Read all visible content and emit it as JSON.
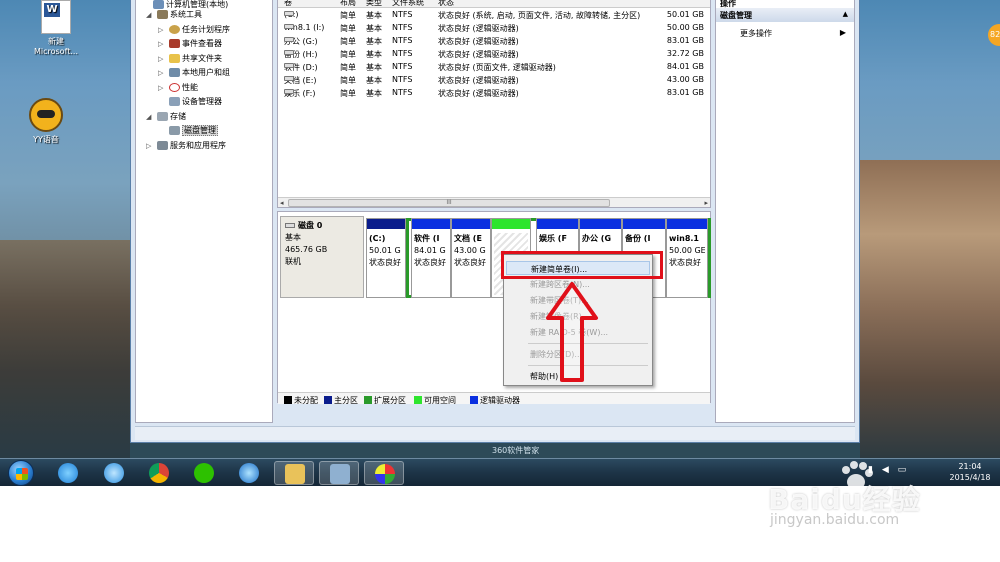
{
  "desktop": {
    "icons": [
      {
        "label": "新建\nMicrosoft..."
      },
      {
        "label": "YY语音"
      }
    ],
    "overlay_text": "360软件管家"
  },
  "nav_tree": {
    "items": [
      {
        "label": "计算机管理(本地)",
        "glyph": "",
        "level": 0
      },
      {
        "label": "系统工具",
        "glyph": "◢",
        "level": 1
      },
      {
        "label": "任务计划程序",
        "glyph": "▷",
        "level": 2
      },
      {
        "label": "事件查看器",
        "glyph": "▷",
        "level": 2
      },
      {
        "label": "共享文件夹",
        "glyph": "▷",
        "level": 2
      },
      {
        "label": "本地用户和组",
        "glyph": "▷",
        "level": 2
      },
      {
        "label": "性能",
        "glyph": "▷",
        "level": 2
      },
      {
        "label": "设备管理器",
        "glyph": "",
        "level": 2
      },
      {
        "label": "存储",
        "glyph": "◢",
        "level": 1
      },
      {
        "label": "磁盘管理",
        "glyph": "",
        "level": 2,
        "selected": true
      },
      {
        "label": "服务和应用程序",
        "glyph": "▷",
        "level": 1
      }
    ]
  },
  "volume_list": {
    "headers": [
      "卷",
      "布局",
      "类型",
      "文件系统",
      "状态"
    ],
    "rows": [
      {
        "name": "(C:)",
        "layout": "简单",
        "type": "基本",
        "fs": "NTFS",
        "status": "状态良好 (系统, 启动, 页面文件, 活动, 故障转储, 主分区)",
        "capacity": "50.01 GB"
      },
      {
        "name": "win8.1 (I:)",
        "layout": "简单",
        "type": "基本",
        "fs": "NTFS",
        "status": "状态良好 (逻辑驱动器)",
        "capacity": "50.00 GB"
      },
      {
        "name": "办公 (G:)",
        "layout": "简单",
        "type": "基本",
        "fs": "NTFS",
        "status": "状态良好 (逻辑驱动器)",
        "capacity": "83.01 GB"
      },
      {
        "name": "备份 (H:)",
        "layout": "简单",
        "type": "基本",
        "fs": "NTFS",
        "status": "状态良好 (逻辑驱动器)",
        "capacity": "32.72 GB"
      },
      {
        "name": "软件 (D:)",
        "layout": "简单",
        "type": "基本",
        "fs": "NTFS",
        "status": "状态良好 (页面文件, 逻辑驱动器)",
        "capacity": "84.01 GB"
      },
      {
        "name": "文档 (E:)",
        "layout": "简单",
        "type": "基本",
        "fs": "NTFS",
        "status": "状态良好 (逻辑驱动器)",
        "capacity": "43.00 GB"
      },
      {
        "name": "娱乐 (F:)",
        "layout": "简单",
        "type": "基本",
        "fs": "NTFS",
        "status": "状态良好 (逻辑驱动器)",
        "capacity": "83.01 GB"
      }
    ],
    "scroll_grip": "III"
  },
  "disk": {
    "name": "磁盘 0",
    "type": "基本",
    "size": "465.76 GB",
    "state": "联机",
    "partitions": [
      {
        "name": "(C:)",
        "size": "50.01 G",
        "status": "状态良好",
        "bar": "#0a1c8c"
      },
      {
        "name": "软件 (I",
        "size": "84.01 G",
        "status": "状态良好",
        "bar": "#0a2fe0"
      },
      {
        "name": "文档 (E",
        "size": "43.00 G",
        "status": "状态良好",
        "bar": "#0a2fe0"
      },
      {
        "name": "",
        "size": "",
        "status": "",
        "bar": "#2ee52e"
      },
      {
        "name": "娱乐 (F",
        "size": "",
        "status": "",
        "bar": "#0a2fe0"
      },
      {
        "name": "办公 (G",
        "size": "",
        "status": "",
        "bar": "#0a2fe0"
      },
      {
        "name": "备份 (I",
        "size": "",
        "status": "",
        "bar": "#0a2fe0"
      },
      {
        "name": "win8.1",
        "size": "50.00 GE",
        "status": "状态良好",
        "bar": "#0a2fe0"
      }
    ]
  },
  "legend": [
    {
      "label": "未分配",
      "color": "#000000"
    },
    {
      "label": "主分区",
      "color": "#0a1c8c"
    },
    {
      "label": "扩展分区",
      "color": "#2a9a2a"
    },
    {
      "label": "可用空间",
      "color": "#2ee52e"
    },
    {
      "label": "逻辑驱动器",
      "color": "#0a2fe0"
    }
  ],
  "actions": {
    "header": "操作",
    "section": "磁盘管理",
    "more": "更多操作"
  },
  "context_menu": {
    "items": [
      {
        "label": "新建简单卷(I)...",
        "enabled": true,
        "highlighted": true
      },
      {
        "label": "新建跨区卷(N)...",
        "enabled": false
      },
      {
        "label": "新建带区卷(T)...",
        "enabled": false
      },
      {
        "label": "新建镜像卷(R)...",
        "enabled": false
      },
      {
        "label": "新建 RAID-5 卷(W)...",
        "enabled": false
      },
      {
        "label": "删除分区(D)...",
        "enabled": false
      },
      {
        "label": "帮助(H)",
        "enabled": true
      }
    ]
  },
  "taskbar": {
    "clock_time": "21:04",
    "clock_date": "2015/4/18",
    "badge": "82"
  },
  "watermark": {
    "brand": "Baidu经验",
    "url": "jingyan.baidu.com"
  },
  "colors": {
    "annotation_red": "#e0101a",
    "extended_green": "#2a9a2a"
  }
}
